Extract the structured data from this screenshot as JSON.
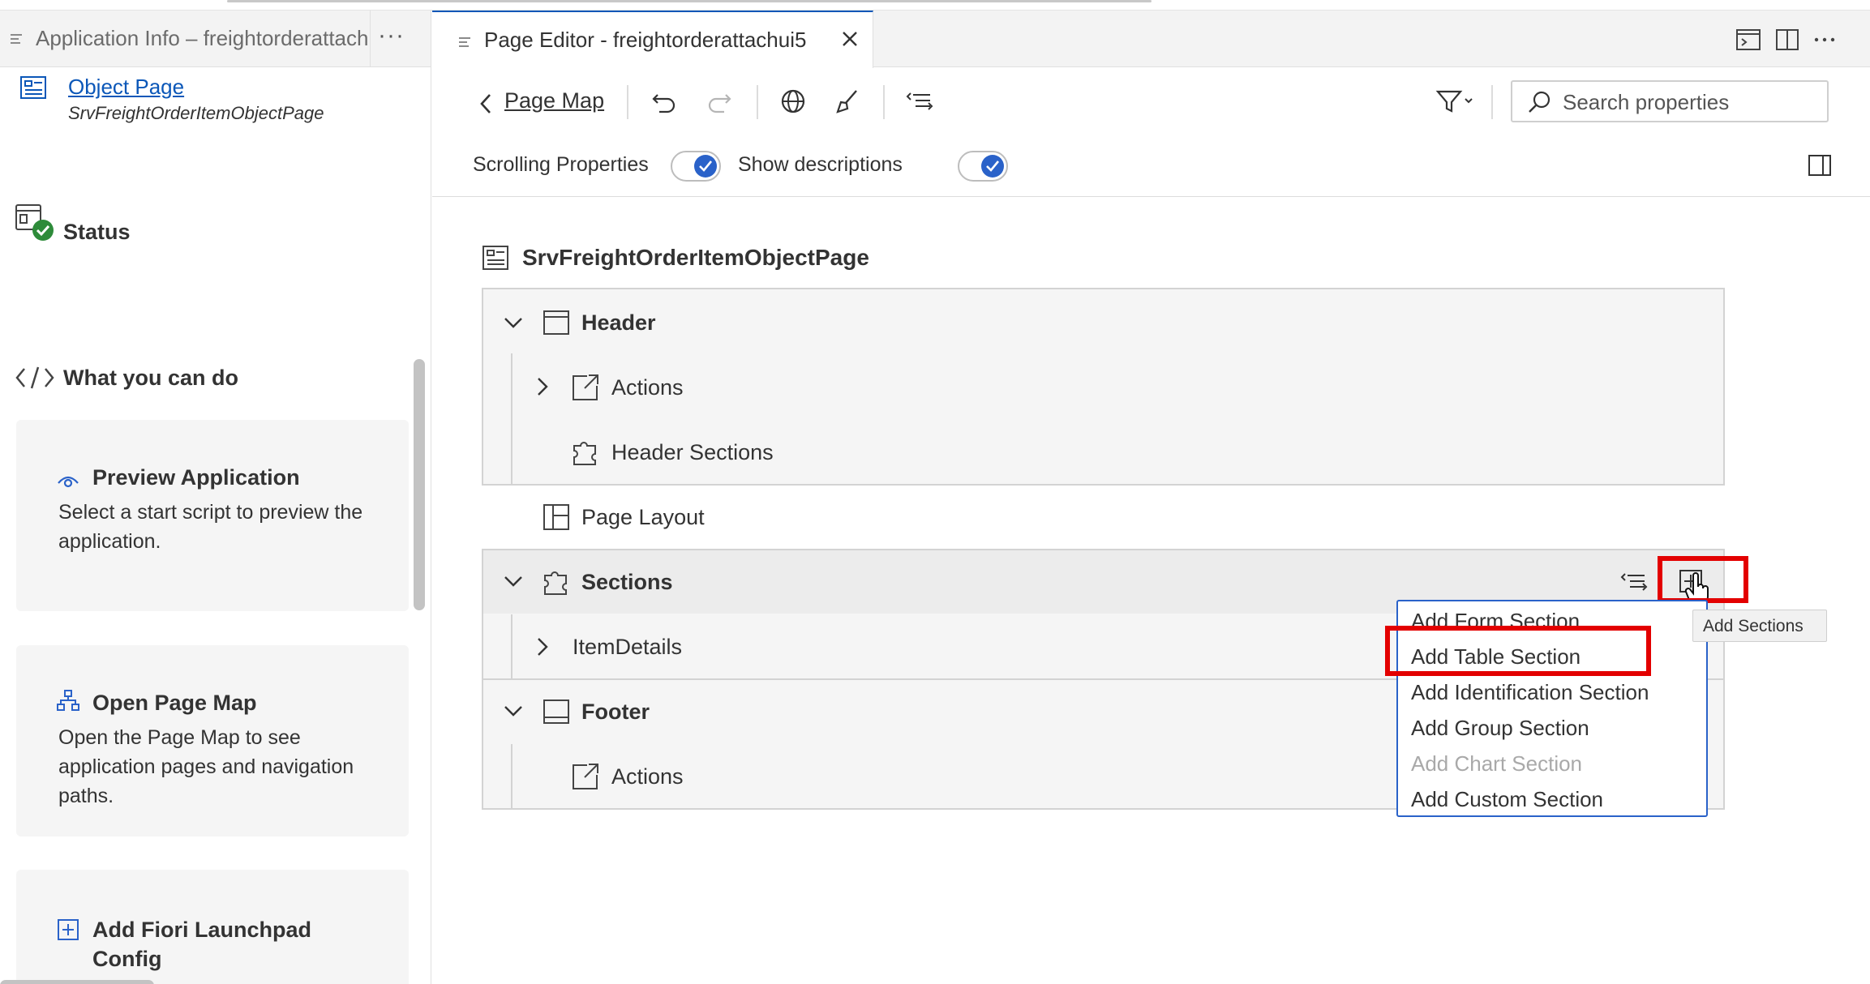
{
  "left_panel": {
    "tab_title": "Application Info – freightorderattachui5",
    "more_label": "···",
    "object_page_link": "Object Page",
    "object_page_name": "SrvFreightOrderItemObjectPage",
    "status_heading": "Status",
    "what_you_can_do": "What you can do",
    "cards": [
      {
        "title": "Preview Application",
        "desc": "Select a start script to preview the application."
      },
      {
        "title": "Open Page Map",
        "desc": "Open the Page Map to see application pages and navigation paths."
      },
      {
        "title": "Add Fiori Launchpad Config",
        "desc": ""
      }
    ]
  },
  "editor": {
    "tab_title": "Page Editor - freightorderattachui5",
    "toolbar": {
      "page_map": "Page Map",
      "search_placeholder": "Search properties"
    },
    "props": {
      "scrolling_label": "Scrolling Properties",
      "scrolling_on": true,
      "descriptions_label": "Show descriptions",
      "descriptions_on": true
    },
    "page_title": "SrvFreightOrderItemObjectPage",
    "tree": {
      "header": "Header",
      "header_actions": "Actions",
      "header_sections": "Header Sections",
      "page_layout": "Page Layout",
      "sections": "Sections",
      "item_details": "ItemDetails",
      "footer": "Footer",
      "footer_actions": "Actions"
    },
    "add_sections_tooltip": "Add Sections",
    "dropdown_items": [
      {
        "label": "Add Form Section",
        "disabled": false
      },
      {
        "label": "Add Table Section",
        "disabled": false,
        "highlighted": true
      },
      {
        "label": "Add Identification Section",
        "disabled": false
      },
      {
        "label": "Add Group Section",
        "disabled": false
      },
      {
        "label": "Add Chart Section",
        "disabled": true
      },
      {
        "label": "Add Custom Section",
        "disabled": false
      }
    ]
  },
  "colors": {
    "accent": "#2a62c9",
    "link": "#0b57b8",
    "highlight": "#e30000",
    "status_ok": "#2e8b3a"
  }
}
